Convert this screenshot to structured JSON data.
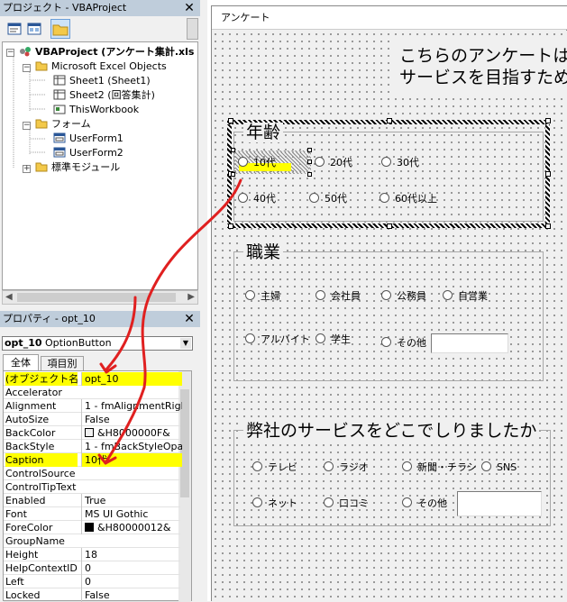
{
  "project_panel": {
    "title": "プロジェクト - VBAProject",
    "close": "✕",
    "tree": {
      "root": "VBAProject (アンケート集計.xls",
      "excel_objects": "Microsoft Excel Objects",
      "sheet1": "Sheet1 (Sheet1)",
      "sheet2": "Sheet2 (回答集計)",
      "workbook": "ThisWorkbook",
      "forms": "フォーム",
      "userform1": "UserForm1",
      "userform2": "UserForm2",
      "modules": "標準モジュール"
    }
  },
  "properties_panel": {
    "title": "プロパティ - opt_10",
    "close": "✕",
    "object_select": {
      "name": "opt_10",
      "type": "OptionButton"
    },
    "tabs": [
      "全体",
      "項目別"
    ],
    "rows": [
      {
        "name": "(オブジェクト名)",
        "value": "opt_10",
        "highlight": true
      },
      {
        "name": "Accelerator",
        "value": ""
      },
      {
        "name": "Alignment",
        "value": "1 - fmAlignmentRigh"
      },
      {
        "name": "AutoSize",
        "value": "False"
      },
      {
        "name": "BackColor",
        "value": "&H8000000F&",
        "swatch": "#f0f0f0"
      },
      {
        "name": "BackStyle",
        "value": "1 - fmBackStyleOpa"
      },
      {
        "name": "Caption",
        "value": "10代",
        "highlight": true
      },
      {
        "name": "ControlSource",
        "value": ""
      },
      {
        "name": "ControlTipText",
        "value": ""
      },
      {
        "name": "Enabled",
        "value": "True"
      },
      {
        "name": "Font",
        "value": "MS UI Gothic"
      },
      {
        "name": "ForeColor",
        "value": "&H80000012&",
        "swatch": "#000000"
      },
      {
        "name": "GroupName",
        "value": ""
      },
      {
        "name": "Height",
        "value": "18"
      },
      {
        "name": "HelpContextID",
        "value": "0"
      },
      {
        "name": "Left",
        "value": "0"
      },
      {
        "name": "Locked",
        "value": "False"
      }
    ]
  },
  "form": {
    "title": "アンケート",
    "intro_line1": "こちらのアンケートは",
    "intro_line2": "サービスを目指すため",
    "age": {
      "label": "年齢",
      "options": [
        "10代",
        "20代",
        "30代",
        "40代",
        "50代",
        "60代以上"
      ]
    },
    "job": {
      "label": "職業",
      "options": [
        "主婦",
        "会社員",
        "公務員",
        "自営業",
        "アルバイト",
        "学生",
        "その他"
      ]
    },
    "source": {
      "label": "弊社のサービスをどこでしりましたか",
      "options": [
        "テレビ",
        "ラジオ",
        "新聞・チラシ",
        "SNS",
        "ネット",
        "口コミ",
        "その他"
      ]
    }
  },
  "colors": {
    "highlight": "#ffff00",
    "arrow": "#e02020",
    "panel_title_bg": "#bfcddb"
  }
}
